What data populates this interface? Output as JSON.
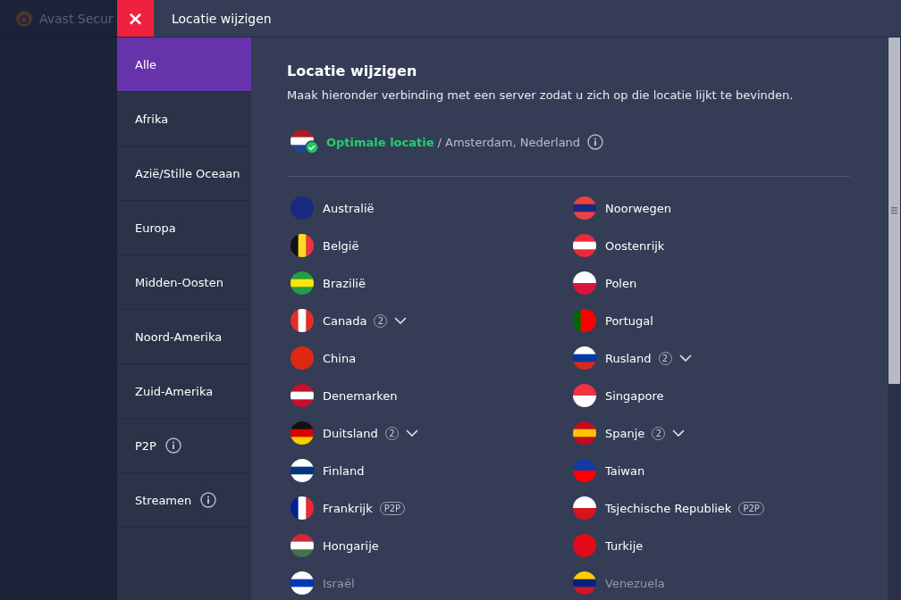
{
  "background_app": {
    "title": "Avast Secur"
  },
  "window": {
    "title": "Locatie wijzigen",
    "close": "×"
  },
  "sidebar": {
    "items": [
      {
        "label": "Alle",
        "selected": true,
        "info": false
      },
      {
        "label": "Afrika",
        "selected": false,
        "info": false
      },
      {
        "label": "Azië/Stille Oceaan",
        "selected": false,
        "info": false
      },
      {
        "label": "Europa",
        "selected": false,
        "info": false
      },
      {
        "label": "Midden-Oosten",
        "selected": false,
        "info": false
      },
      {
        "label": "Noord-Amerika",
        "selected": false,
        "info": false
      },
      {
        "label": "Zuid-Amerika",
        "selected": false,
        "info": false
      },
      {
        "label": "P2P",
        "selected": false,
        "info": true
      },
      {
        "label": "Streamen",
        "selected": false,
        "info": true
      }
    ]
  },
  "content": {
    "heading": "Locatie wijzigen",
    "description": "Maak hieronder verbinding met een server zodat u zich op die locatie lijkt te bevinden.",
    "optimal": {
      "label": "Optimale locatie",
      "location": "/ Amsterdam, Nederland"
    },
    "countries": [
      {
        "name": "Australië",
        "dimmed": false
      },
      {
        "name": "Noorwegen",
        "dimmed": false
      },
      {
        "name": "België",
        "dimmed": false
      },
      {
        "name": "Oostenrijk",
        "dimmed": false
      },
      {
        "name": "Brazilië",
        "dimmed": false
      },
      {
        "name": "Polen",
        "dimmed": false
      },
      {
        "name": "Canada",
        "dimmed": false,
        "count": "2"
      },
      {
        "name": "Portugal",
        "dimmed": false
      },
      {
        "name": "China",
        "dimmed": false
      },
      {
        "name": "Rusland",
        "dimmed": false,
        "count": "2"
      },
      {
        "name": "Denemarken",
        "dimmed": false
      },
      {
        "name": "Singapore",
        "dimmed": false
      },
      {
        "name": "Duitsland",
        "dimmed": false,
        "count": "2"
      },
      {
        "name": "Spanje",
        "dimmed": false,
        "count": "2"
      },
      {
        "name": "Finland",
        "dimmed": false
      },
      {
        "name": "Taiwan",
        "dimmed": false
      },
      {
        "name": "Frankrijk",
        "dimmed": false,
        "tag": "P2P"
      },
      {
        "name": "Tsjechische Republiek",
        "dimmed": false,
        "tag": "P2P"
      },
      {
        "name": "Hongarije",
        "dimmed": false
      },
      {
        "name": "Turkije",
        "dimmed": false
      },
      {
        "name": "Israël",
        "dimmed": true
      },
      {
        "name": "Venezuela",
        "dimmed": true
      }
    ]
  }
}
